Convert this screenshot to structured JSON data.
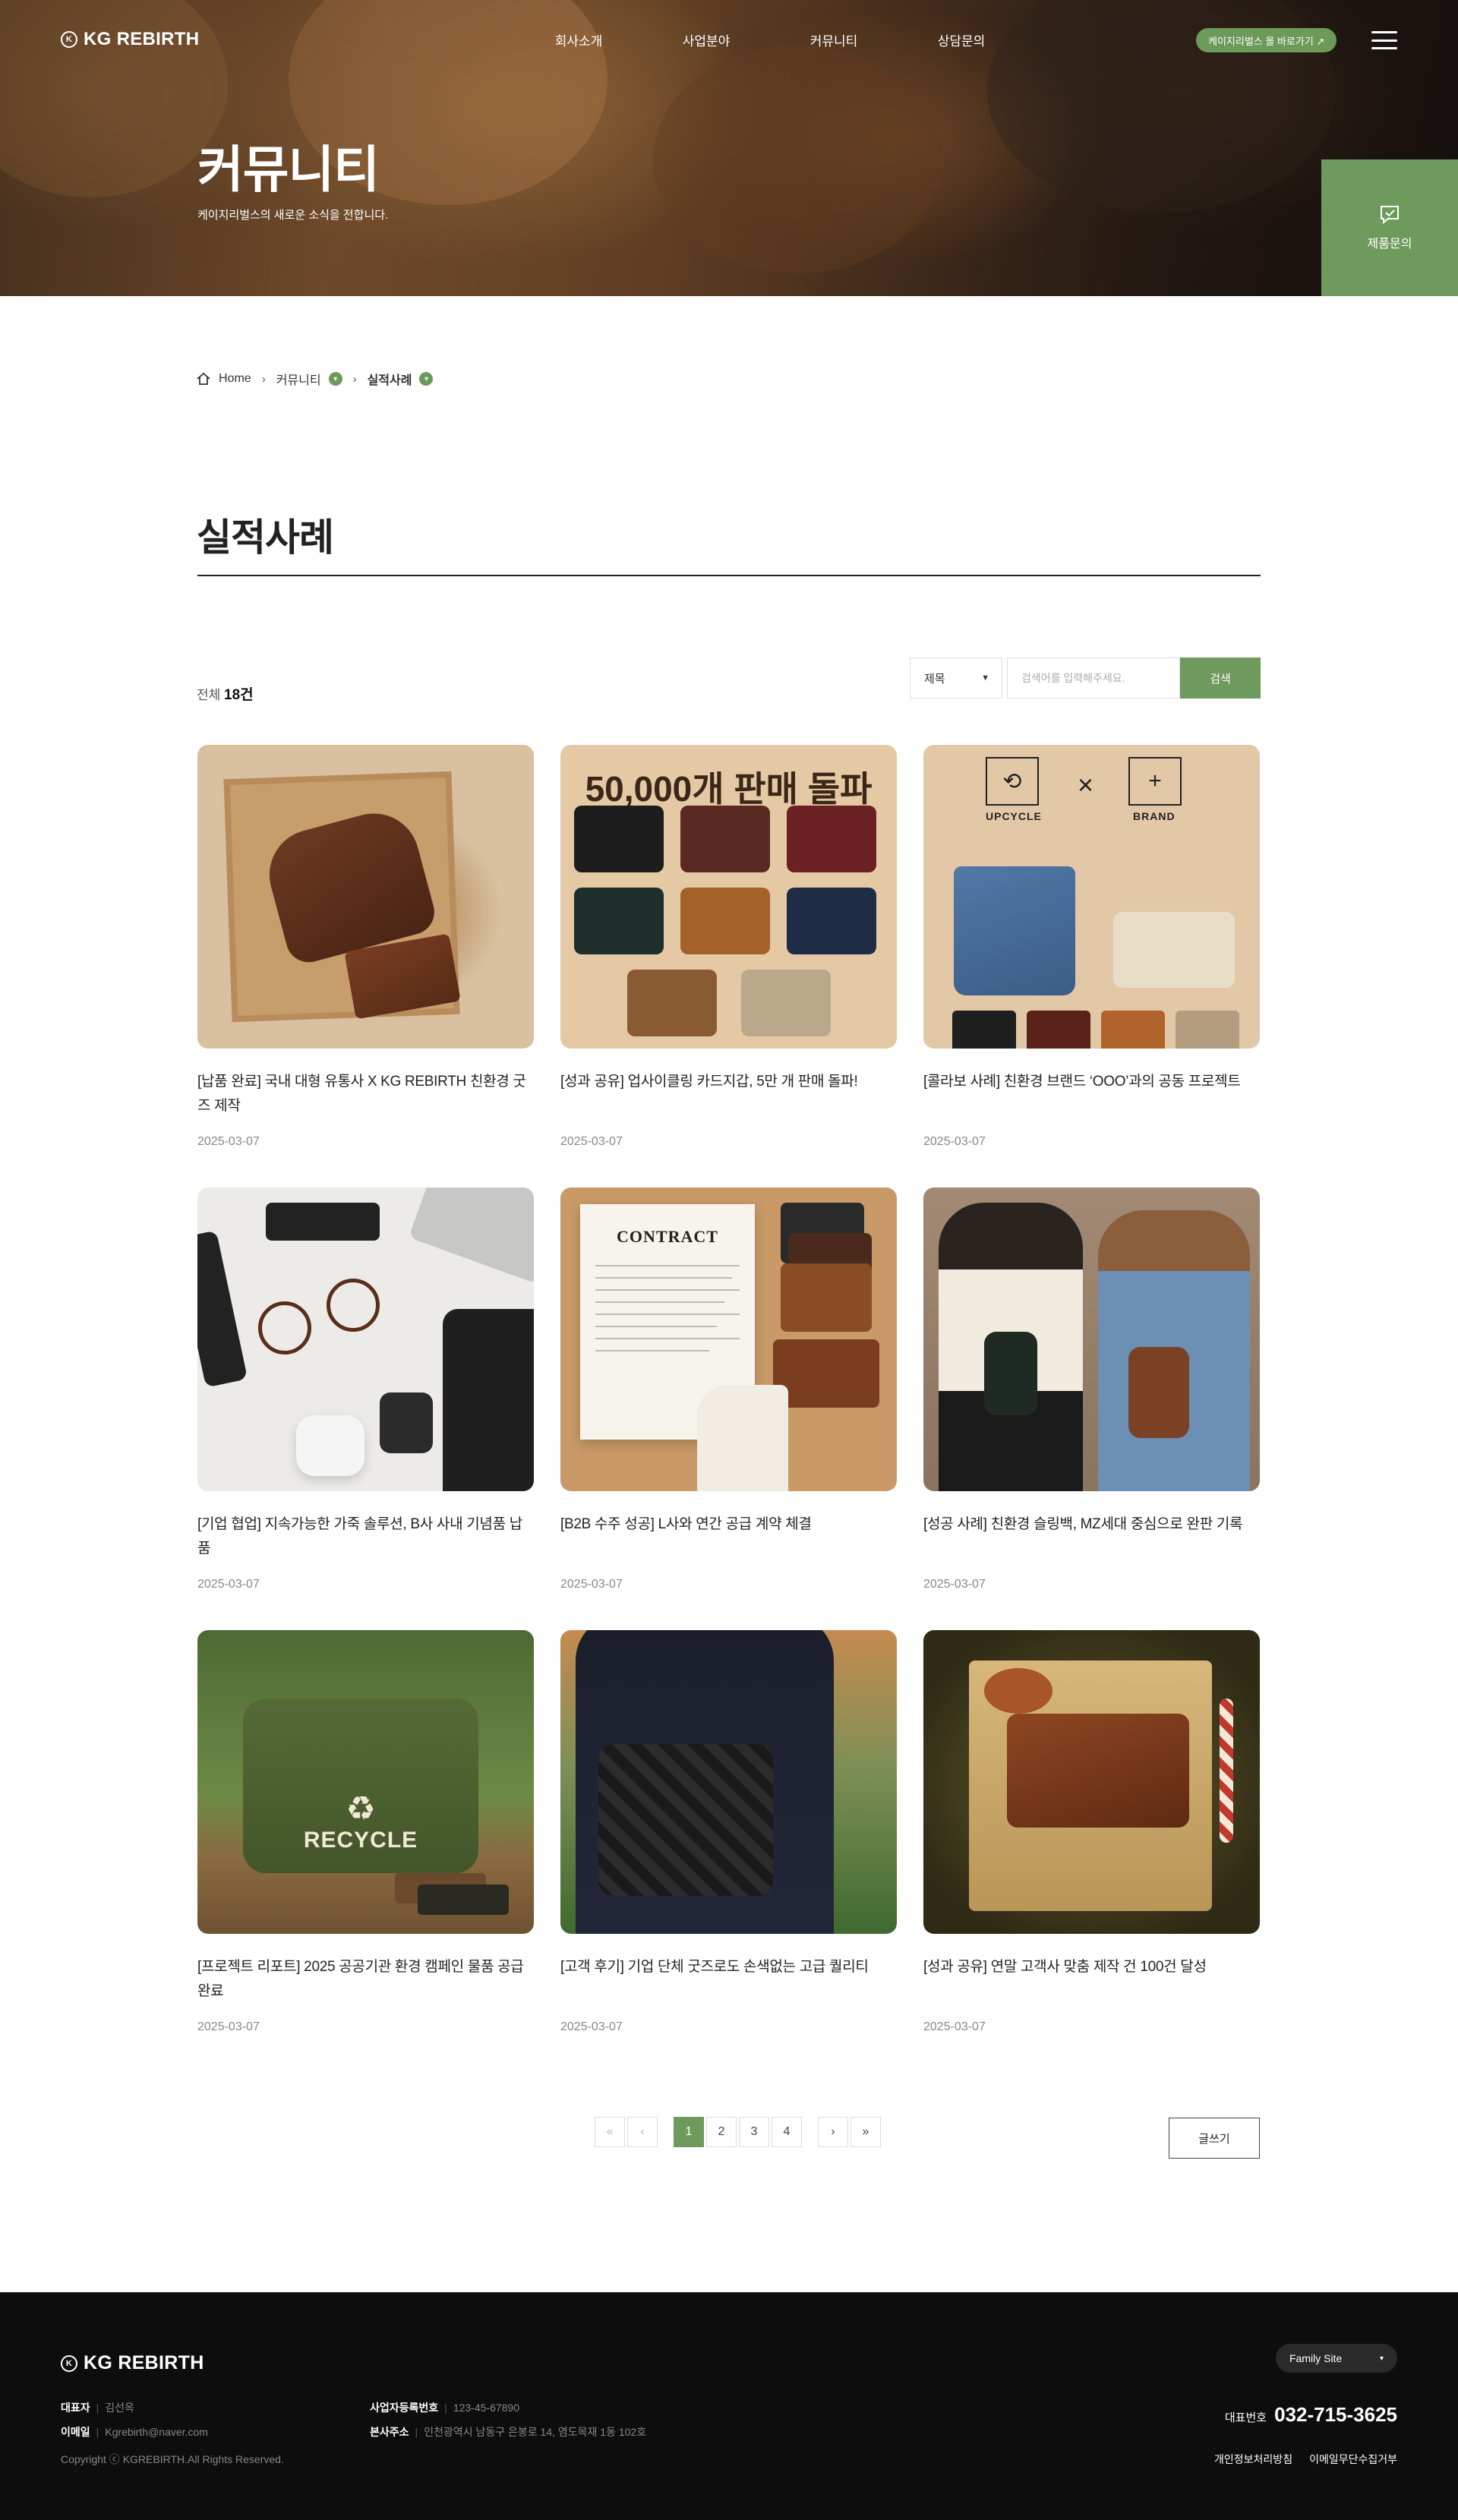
{
  "header": {
    "logo_text": "KG REBIRTH",
    "logo_mark": "K",
    "nav": [
      "회사소개",
      "사업분야",
      "커뮤니티",
      "상담문의"
    ],
    "mall_button": "케이지리벌스 몰 바로가기 ↗",
    "menu_icon": "hamburger-icon"
  },
  "hero": {
    "title": "커뮤니티",
    "subtitle": "케이지리벌스의 새로운 소식을 전합니다.",
    "inquiry_label": "제품문의",
    "inquiry_icon": "chat-check-icon"
  },
  "breadcrumb": {
    "home": "Home",
    "level1": "커뮤니티",
    "level2": "실적사례",
    "sep": "›",
    "dot": "▾"
  },
  "page": {
    "title": "실적사례",
    "total_label": "전체",
    "total_count": "18건"
  },
  "search": {
    "select_value": "제목",
    "select_arrow": "▼",
    "placeholder": "검색어를 입력해주세요.",
    "button": "검색"
  },
  "thumb_text": {
    "sales_banner": "50,000개 판매 돌파",
    "upcycle_label": "UPCYCLE",
    "brand_label": "BRAND",
    "upcycle_icon": "⟲",
    "brand_icon": "+",
    "times": "×",
    "contract_heading": "CONTRACT",
    "recycle_symbol": "♻",
    "recycle_label": "RECYCLE"
  },
  "posts": [
    {
      "title": "[납품 완료] 국내 대형 유통사 X KG REBIRTH 친환경 굿즈 제작",
      "date": "2025-03-07"
    },
    {
      "title": "[성과 공유] 업사이클링 카드지갑, 5만 개 판매 돌파!",
      "date": "2025-03-07"
    },
    {
      "title": "[콜라보 사례] 친환경 브랜드 ‘OOO’과의 공동 프로젝트",
      "date": "2025-03-07"
    },
    {
      "title": "[기업 협업] 지속가능한 가죽 솔루션, B사 사내 기념품 납품",
      "date": "2025-03-07"
    },
    {
      "title": "[B2B 수주 성공] L사와 연간 공급 계약 체결",
      "date": "2025-03-07"
    },
    {
      "title": "[성공 사례] 친환경 슬링백, MZ세대 중심으로 완판 기록",
      "date": "2025-03-07"
    },
    {
      "title": "[프로젝트 리포트] 2025 공공기관 환경 캠페인 물품 공급 완료",
      "date": "2025-03-07"
    },
    {
      "title": "[고객 후기] 기업 단체 굿즈로도 손색없는 고급 퀄리티",
      "date": "2025-03-07"
    },
    {
      "title": "[성과 공유] 연말 고객사 맞춤 제작 건 100건 달성",
      "date": "2025-03-07"
    }
  ],
  "pagination": {
    "first": "«",
    "prev": "‹",
    "pages": [
      "1",
      "2",
      "3",
      "4"
    ],
    "current": "1",
    "next": "›",
    "last": "»"
  },
  "write_button": "글쓰기",
  "footer": {
    "logo_text": "KG REBIRTH",
    "ceo_label": "대표자",
    "ceo": "김선옥",
    "email_label": "이메일",
    "email": "Kgrebirth@naver.com",
    "biz_label": "사업자등록번호",
    "biz_no": "123-45-67890",
    "addr_label": "본사주소",
    "address": "인천광역시 남동구 은봉로 14, 염도목재 1동 102호",
    "copyright": "Copyright ⓒ KGREBIRTH.All Rights Reserved.",
    "family_site": "Family Site",
    "family_arrow": "▾",
    "tel_label": "대표번호",
    "tel": "032-715-3625",
    "links": [
      "개인정보처리방침",
      "이메일무단수집거부"
    ]
  },
  "colors": {
    "accent_green": "#6f9a5d",
    "footer_bg": "#0d0d0d"
  }
}
